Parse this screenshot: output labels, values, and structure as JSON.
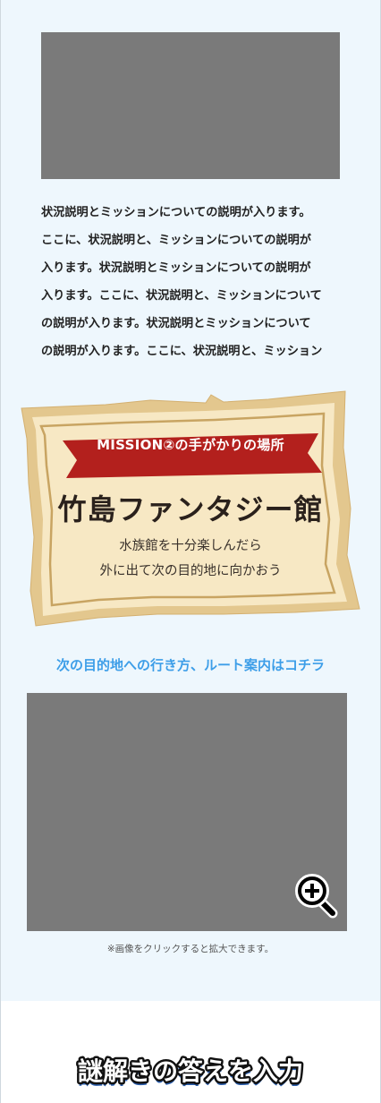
{
  "description": {
    "lines": [
      "状況説明とミッションについての説明が入ります。",
      "ここに、状況説明と、ミッションについての説明が",
      "入ります。状況説明とミッションについての説明が",
      "入ります。ここに、状況説明と、ミッションについて",
      "の説明が入ります。状況説明とミッションについて",
      "の説明が入ります。ここに、状況説明と、ミッション"
    ]
  },
  "mission_card": {
    "ribbon_label": "MISSION②の手がかりの場所",
    "place_name": "竹島ファンタジー館",
    "hint_line_1": "水族館を十分楽しんだら",
    "hint_line_2": "外に出て次の目的地に向かおう"
  },
  "route_link": "次の目的地への行き方、ルート案内はコチラ",
  "map": {
    "zoom_icon": "zoom-in-icon",
    "note": "※画像をクリックすると拡大できます。"
  },
  "answer_heading": "謎解きの答えを入力",
  "colors": {
    "panel_bg": "#eef7fd",
    "link_blue": "#3d9ee8",
    "ribbon_red": "#b3201d",
    "parchment": "#f6e6bf",
    "parchment_edge": "#e2c78e",
    "heading_blue": "#2a5fb0"
  }
}
